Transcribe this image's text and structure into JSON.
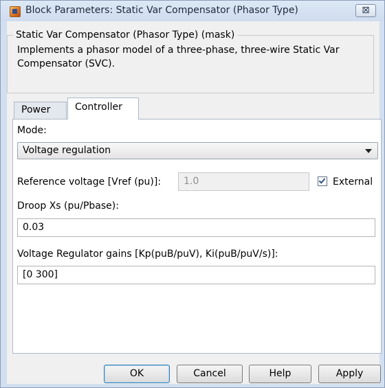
{
  "window": {
    "title": "Block Parameters: Static Var Compensator (Phasor Type)",
    "close_symbol": "⊠",
    "icon": "simulink-block-icon"
  },
  "mask": {
    "title": "Static Var Compensator (Phasor Type) (mask)",
    "description": "Implements a phasor model of a three-phase, three-wire Static Var Compensator (SVC)."
  },
  "tabs": [
    {
      "label": "Power",
      "active": false
    },
    {
      "label": "Controller",
      "active": true
    }
  ],
  "controller": {
    "mode_label": "Mode:",
    "mode_value": "Voltage regulation",
    "vref_label": "Reference voltage [Vref (pu)]:",
    "vref_value": "1.0",
    "external_label": "External",
    "external_checked": true,
    "droop_label": "Droop Xs (pu/Pbase):",
    "droop_value": "0.03",
    "gains_label": "Voltage Regulator gains [Kp(puB/puV), Ki(puB/puV/s)]:",
    "gains_value": "[0 300]"
  },
  "buttons": {
    "ok": "OK",
    "cancel": "Cancel",
    "help": "Help",
    "apply": "Apply"
  },
  "colors": {
    "frame": "#d2dff0",
    "client": "#f0f0f0",
    "panel": "#ffffff",
    "default_button_border": "#3c7fb1"
  }
}
